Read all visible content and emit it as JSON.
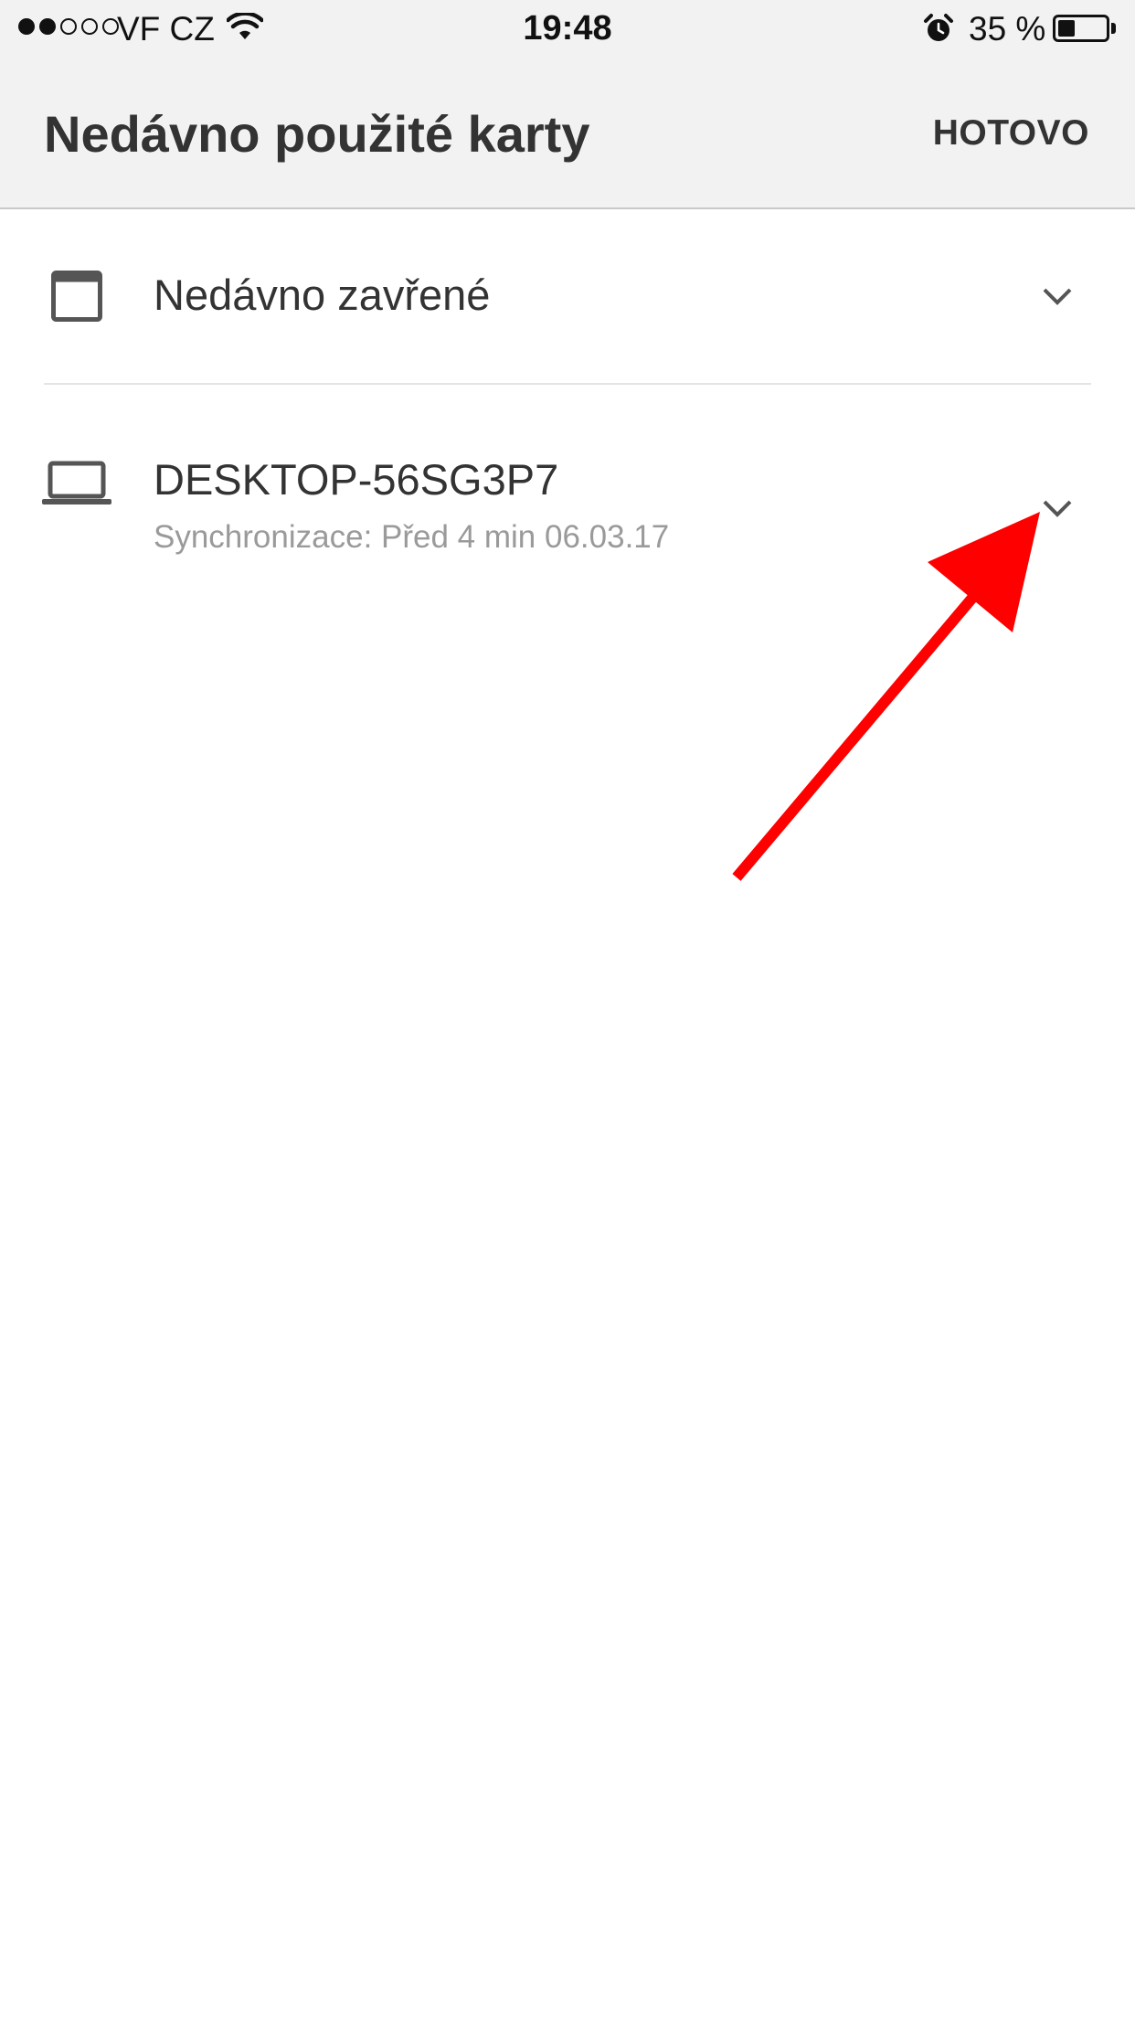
{
  "status_bar": {
    "carrier": "VF CZ",
    "signal_bars_filled": 2,
    "signal_bars_total": 5,
    "time": "19:48",
    "battery_text": "35 %",
    "battery_level": 0.35,
    "icons": [
      "wifi-icon",
      "alarm-clock-icon",
      "battery-icon"
    ]
  },
  "app_bar": {
    "title": "Nedávno použité karty",
    "done_label": "HOTOVO"
  },
  "list": {
    "recently_closed": {
      "icon": "browser-window-icon",
      "label": "Nedávno zavřené",
      "expand_icon": "chevron-down-icon"
    },
    "device": {
      "icon": "laptop-icon",
      "name": "DESKTOP-56SG3P7",
      "sync_status": "Synchronizace: Před 4 min 06.03.17",
      "expand_icon": "chevron-down-icon"
    }
  },
  "annotation": {
    "icon": "red-arrow-icon",
    "color": "#ff0000"
  },
  "colors": {
    "app_bar_background": "#f2f2f2",
    "text_primary": "#333333",
    "text_secondary": "#9a9a9a",
    "divider": "#e4e4e4"
  }
}
